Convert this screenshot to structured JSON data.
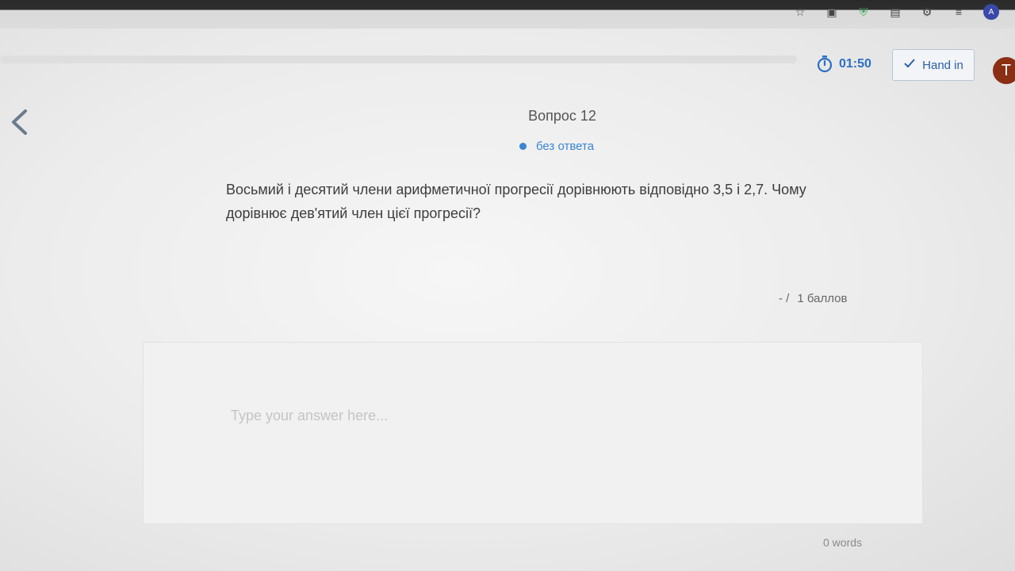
{
  "header": {
    "timer": "01:50",
    "hand_in_label": "Hand in",
    "user_initial": "T"
  },
  "question": {
    "title": "Вопрос 12",
    "status": "без ответа",
    "text": "Восьмий і десятий члени арифметичної прогресії дорівнюють відповідно 3,5 і 2,7. Чому дорівнює дев'ятий член цієї прогресії?",
    "points_prefix": "- /",
    "points_value": "1 баллов"
  },
  "answer": {
    "placeholder": "Type your answer here...",
    "word_count": "0 words"
  },
  "colors": {
    "accent": "#2b6fc2",
    "avatar": "#8a2e14",
    "status_dot": "#3a86d1"
  },
  "icons": {
    "back": "chevron-left-icon",
    "timer": "stopwatch-icon",
    "hand_in": "checkmark-icon",
    "extensions": [
      "star-icon",
      "extension-icon",
      "shield-icon",
      "puzzle-icon",
      "settings-icon"
    ]
  }
}
